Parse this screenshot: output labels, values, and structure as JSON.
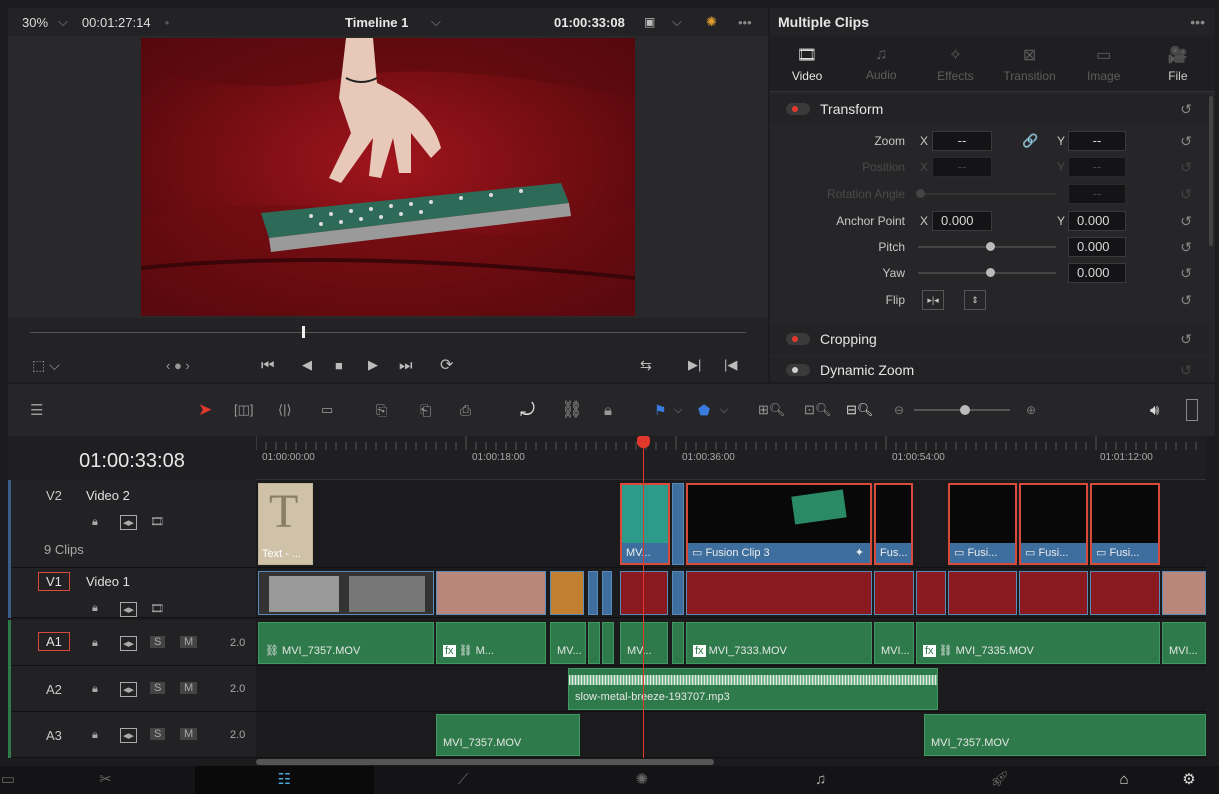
{
  "viewer": {
    "zoom": "30%",
    "timecode_left": "00:01:27:14",
    "timeline_name": "Timeline 1",
    "timecode_right": "01:00:33:08"
  },
  "inspector": {
    "title": "Multiple Clips",
    "tabs": [
      {
        "label": "Video",
        "icon": "film-icon"
      },
      {
        "label": "Audio",
        "icon": "music-icon"
      },
      {
        "label": "Effects",
        "icon": "wand-icon"
      },
      {
        "label": "Transition",
        "icon": "transition-icon"
      },
      {
        "label": "Image",
        "icon": "image-icon"
      },
      {
        "label": "File",
        "icon": "file-icon"
      }
    ],
    "transform": {
      "title": "Transform",
      "zoom": "Zoom",
      "position": "Position",
      "rotation": "Rotation Angle",
      "anchor": "Anchor Point",
      "pitch": "Pitch",
      "yaw": "Yaw",
      "flip": "Flip",
      "x": "X",
      "y": "Y",
      "zoom_x": "--",
      "zoom_y": "--",
      "pos_x": "--",
      "pos_y": "--",
      "rot": "--",
      "anchor_x": "0.000",
      "anchor_y": "0.000",
      "pitch_val": "0.000",
      "yaw_val": "0.000"
    },
    "cropping": "Cropping",
    "dynamic_zoom": "Dynamic Zoom"
  },
  "timeline": {
    "timecode": "01:00:33:08",
    "ruler": [
      "01:00:00:00",
      "01:00:18:00",
      "01:00:36:00",
      "01:00:54:00",
      "01:01:12:00"
    ],
    "tracks": {
      "v2": {
        "id": "V2",
        "name": "Video 2",
        "clips": "9 Clips"
      },
      "v1": {
        "id": "V1",
        "name": "Video 1"
      },
      "a1": {
        "id": "A1",
        "level": "2.0"
      },
      "a2": {
        "id": "A2",
        "level": "2.0"
      },
      "a3": {
        "id": "A3",
        "level": "2.0"
      },
      "s": "S",
      "m": "M"
    },
    "v2_clips": {
      "text": "Text - ...",
      "mv": "MV...",
      "fusion3": "Fusion Clip 3",
      "fus": "Fus...",
      "fusi1": "Fusi...",
      "fusi2": "Fusi...",
      "fusi3": "Fusi..."
    },
    "a1_clips": {
      "c1": "MVI_7357.MOV",
      "c2": "M...",
      "c3": "MV...",
      "c4": "MV...",
      "c5": "MVI_7333.MOV",
      "c6": "MVI...",
      "c7": "MVI_7335.MOV",
      "c8": "MVI..."
    },
    "a2_clips": {
      "c1": "slow-metal-breeze-193707.mp3"
    },
    "a3_clips": {
      "c1": "MVI_7357.MOV",
      "c2": "MVI_7357.MOV"
    }
  },
  "colors": {
    "accent": "#d84a3a",
    "playhead": "#e0392c",
    "video_clip": "#3d6e9e",
    "audio_clip": "#2e7a4a"
  }
}
